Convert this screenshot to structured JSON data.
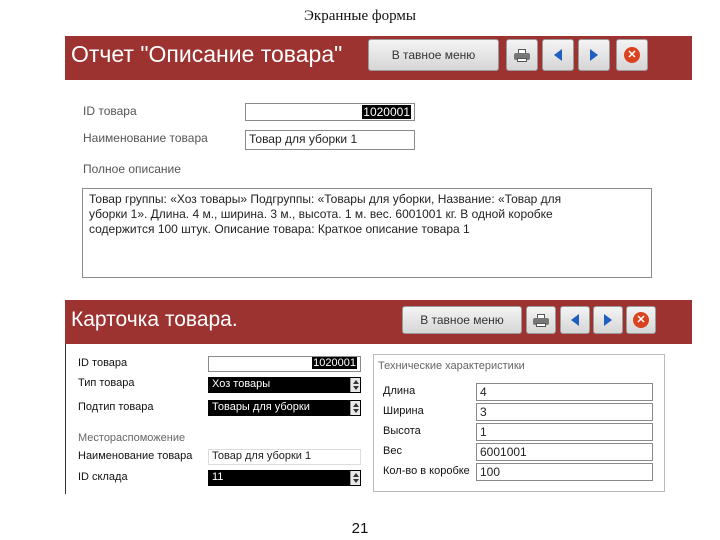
{
  "slide": {
    "title": "Экранные формы",
    "page_number": "21"
  },
  "toolbar": {
    "main_menu_label": "В тавное меню"
  },
  "form1": {
    "title": "Отчет \"Описание товара\"",
    "id_label": "ID товара",
    "id_value": "1020001",
    "name_label": "Наименование товара",
    "name_value": "Товар для уборки 1",
    "full_desc_label": "Полное описание",
    "full_desc_lines": [
      "Товар группы: «Хоз товары» Подгруппы: «Товары для уборки, Название: «Товар для",
      "уборки 1». Длина. 4 м., ширина. 3 м., высота. 1 м. вес. 6001001 кг.  В одной коробке",
      "содержится 100 штук. Описание товара: Краткое описание товара 1"
    ]
  },
  "form2": {
    "title": "Карточка товара.",
    "id_label": "ID товара",
    "id_value": "1020001",
    "type_label": "Тип товара",
    "type_value": "Хоз товары",
    "subtype_label": "Подтип товара",
    "subtype_value": "Товары для уборки",
    "location_section": "Местораспоможение",
    "loc_name_label": "Наименование товара",
    "loc_name_value": "Товар для уборки 1",
    "warehouse_label": "ID склада",
    "warehouse_value": "11",
    "tech_section": "Технические характеристики",
    "length_label": "Длина",
    "length_value": "4",
    "width_label": "Ширина",
    "width_value": "3",
    "height_label": "Высота",
    "height_value": "1",
    "weight_label": "Вес",
    "weight_value": "6001001",
    "qty_label": "Кол-во  в  коробке",
    "qty_value": "100"
  },
  "colors": {
    "header_bg": "#9c3331",
    "nav_arrow": "#1f5fbf",
    "close_red": "#d9431f"
  },
  "icons": [
    "printer-icon",
    "arrow-left-icon",
    "arrow-right-icon",
    "close-icon"
  ]
}
